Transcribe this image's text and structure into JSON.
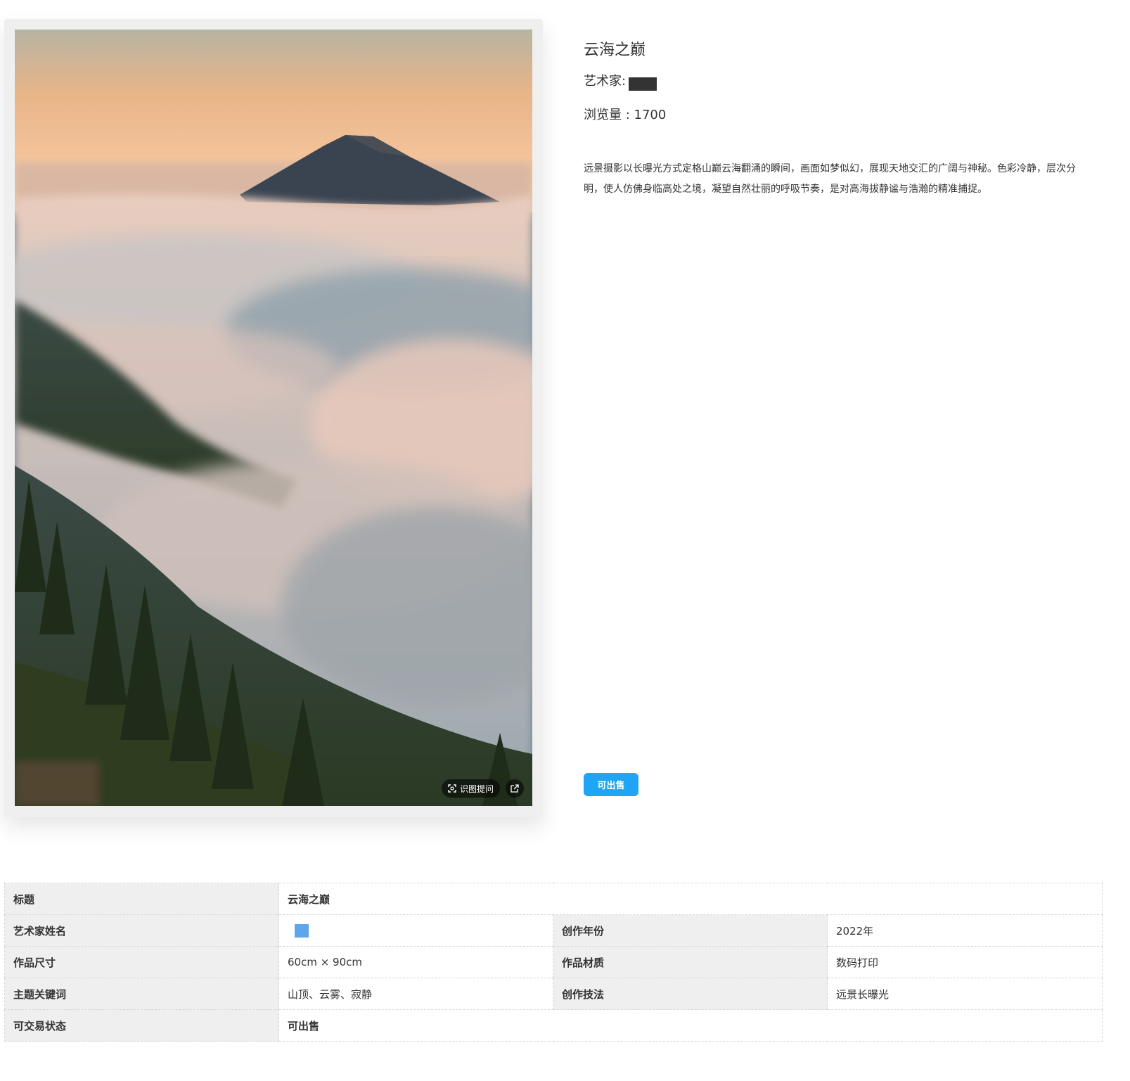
{
  "artwork": {
    "title": "云海之巅",
    "artist_label": "艺术家:",
    "views_text": "浏览量 : 1700",
    "description": "远景摄影以长曝光方式定格山巅云海翻涌的瞬间，画面如梦似幻，展现天地交汇的广阔与神秘。色彩冷静，层次分明，使人仿佛身临高处之境，凝望自然壮丽的呼吸节奏，是对高海拔静谧与浩瀚的精准捕捉。",
    "sale_button": "可出售"
  },
  "image_toolbar": {
    "identify_label": "识图提问",
    "identify_icon": "scan-icon",
    "share_icon": "share-icon"
  },
  "details": {
    "title_label": "标题",
    "title_value": "云海之巅",
    "artist_name_label": "艺术家姓名",
    "year_label": "创作年份",
    "year_value": "2022年",
    "size_label": "作品尺寸",
    "size_value": "60cm × 90cm",
    "material_label": "作品材质",
    "material_value": "数码打印",
    "keywords_label": "主题关键词",
    "keywords_value": "山顶、云雾、寂静",
    "technique_label": "创作技法",
    "technique_value": "远景长曝光",
    "status_label": "可交易状态",
    "status_value": "可出售"
  },
  "colors": {
    "accent": "#1ea5f5",
    "label_bg": "#efefef",
    "text": "#333333"
  }
}
